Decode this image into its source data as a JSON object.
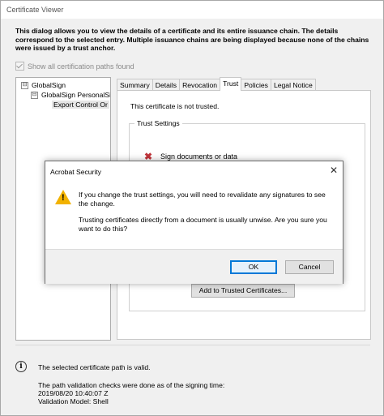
{
  "window": {
    "title": "Certificate Viewer"
  },
  "intro_text": "This dialog allows you to view the details of a certificate and its entire issuance chain. The details correspond to the selected entry. Multiple issuance chains are being displayed because none of the chains were issued by a trust anchor.",
  "show_all_paths": {
    "label": "Show all certification paths found",
    "checked": true
  },
  "tree": {
    "items": [
      {
        "label": "GlobalSign",
        "expander": "⊟"
      },
      {
        "label": "GlobalSign PersonalSi",
        "expander": "⊟"
      },
      {
        "label": "Export Control Or"
      }
    ]
  },
  "tabs": [
    "Summary",
    "Details",
    "Revocation",
    "Trust",
    "Policies",
    "Legal Notice"
  ],
  "trust_panel": {
    "message": "This certificate is not trusted.",
    "group_label": "Trust Settings",
    "item_label": "Sign documents or data",
    "add_button": "Add to Trusted Certificates..."
  },
  "status": {
    "path_valid": "The selected certificate path is valid.",
    "validation_line1": "The path validation checks were done as of the signing time:",
    "validation_line2": "2019/08/20 10:40:07 Z",
    "validation_line3": "Validation Model: Shell"
  },
  "modal": {
    "title": "Acrobat Security",
    "close_glyph": "✕",
    "line1": "If you change the trust settings, you will need to revalidate any signatures to see the change.",
    "line2": "Trusting certificates directly from a document is usually unwise. Are you sure you want to do this?",
    "ok_label": "OK",
    "cancel_label": "Cancel"
  },
  "colors": {
    "warning": "#f2b200",
    "error_x": "#c0343a",
    "button_focus": "#0078d7"
  }
}
